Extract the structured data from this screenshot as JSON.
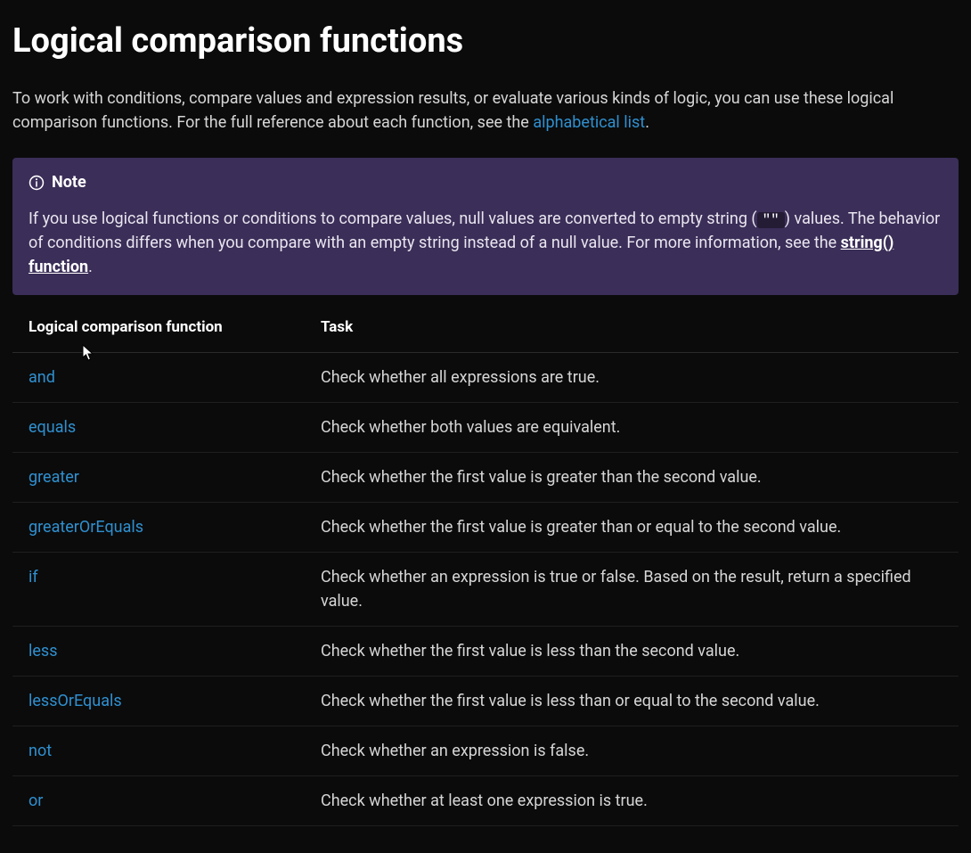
{
  "heading": "Logical comparison functions",
  "intro": {
    "text_before_link": "To work with conditions, compare values and expression results, or evaluate various kinds of logic, you can use these logical comparison functions. For the full reference about each function, see the ",
    "link_text": "alphabetical list",
    "text_after_link": "."
  },
  "note": {
    "label": "Note",
    "text_before_code": "If you use logical functions or conditions to compare values, null values are converted to empty string (",
    "code": "\"\"",
    "text_after_code": ") values. The behavior of conditions differs when you compare with an empty string instead of a null value. For more information, see the ",
    "strong_link_text": "string() function",
    "text_after_link": "."
  },
  "table": {
    "headers": {
      "function": "Logical comparison function",
      "task": "Task"
    },
    "rows": [
      {
        "name": "and",
        "task": "Check whether all expressions are true."
      },
      {
        "name": "equals",
        "task": "Check whether both values are equivalent."
      },
      {
        "name": "greater",
        "task": "Check whether the first value is greater than the second value."
      },
      {
        "name": "greaterOrEquals",
        "task": "Check whether the first value is greater than or equal to the second value."
      },
      {
        "name": "if",
        "task": "Check whether an expression is true or false. Based on the result, return a specified value."
      },
      {
        "name": "less",
        "task": "Check whether the first value is less than the second value."
      },
      {
        "name": "lessOrEquals",
        "task": "Check whether the first value is less than or equal to the second value."
      },
      {
        "name": "not",
        "task": "Check whether an expression is false."
      },
      {
        "name": "or",
        "task": "Check whether at least one expression is true."
      }
    ]
  }
}
